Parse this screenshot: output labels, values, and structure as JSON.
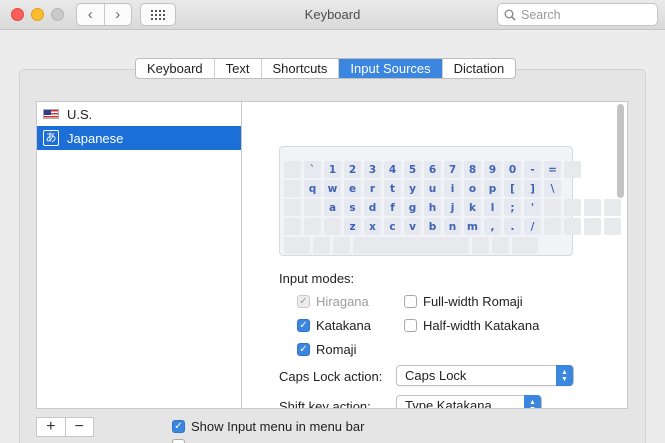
{
  "window": {
    "title": "Keyboard"
  },
  "search": {
    "placeholder": "Search"
  },
  "tabs": [
    {
      "label": "Keyboard"
    },
    {
      "label": "Text"
    },
    {
      "label": "Shortcuts"
    },
    {
      "label": "Input Sources",
      "active": true
    },
    {
      "label": "Dictation"
    }
  ],
  "sources": [
    {
      "label": "U.S.",
      "icon": "us-flag-icon"
    },
    {
      "label": "Japanese",
      "icon": "hiragana-a-icon",
      "glyph": "あ",
      "selected": true
    }
  ],
  "keyboard": {
    "rows": [
      [
        "`",
        "1",
        "2",
        "3",
        "4",
        "5",
        "6",
        "7",
        "8",
        "9",
        "0",
        "-",
        "="
      ],
      [
        "q",
        "w",
        "e",
        "r",
        "t",
        "y",
        "u",
        "i",
        "o",
        "p",
        "[",
        "]",
        "\\"
      ],
      [
        "a",
        "s",
        "d",
        "f",
        "g",
        "h",
        "j",
        "k",
        "l",
        ";",
        "'"
      ],
      [
        "z",
        "x",
        "c",
        "v",
        "b",
        "n",
        "m",
        ",",
        ".",
        "/"
      ]
    ]
  },
  "input_modes": {
    "label": "Input modes:",
    "hiragana": {
      "label": "Hiragana",
      "checked": true,
      "disabled": true
    },
    "katakana": {
      "label": "Katakana",
      "checked": true
    },
    "romaji": {
      "label": "Romaji",
      "checked": true
    },
    "full_width_romaji": {
      "label": "Full-width Romaji",
      "checked": false
    },
    "half_width_katakana": {
      "label": "Half-width Katakana",
      "checked": false
    }
  },
  "caps_lock": {
    "label": "Caps Lock action:",
    "value": "Caps Lock"
  },
  "shift_key": {
    "label": "Shift key action:",
    "value": "Type Katakana"
  },
  "bottom": {
    "show_menu": {
      "label": "Show Input menu in menu bar",
      "checked": true
    }
  },
  "colors": {
    "accent": "#3b86df",
    "selection": "#1d6fd8",
    "key_text": "#3e63b4"
  }
}
